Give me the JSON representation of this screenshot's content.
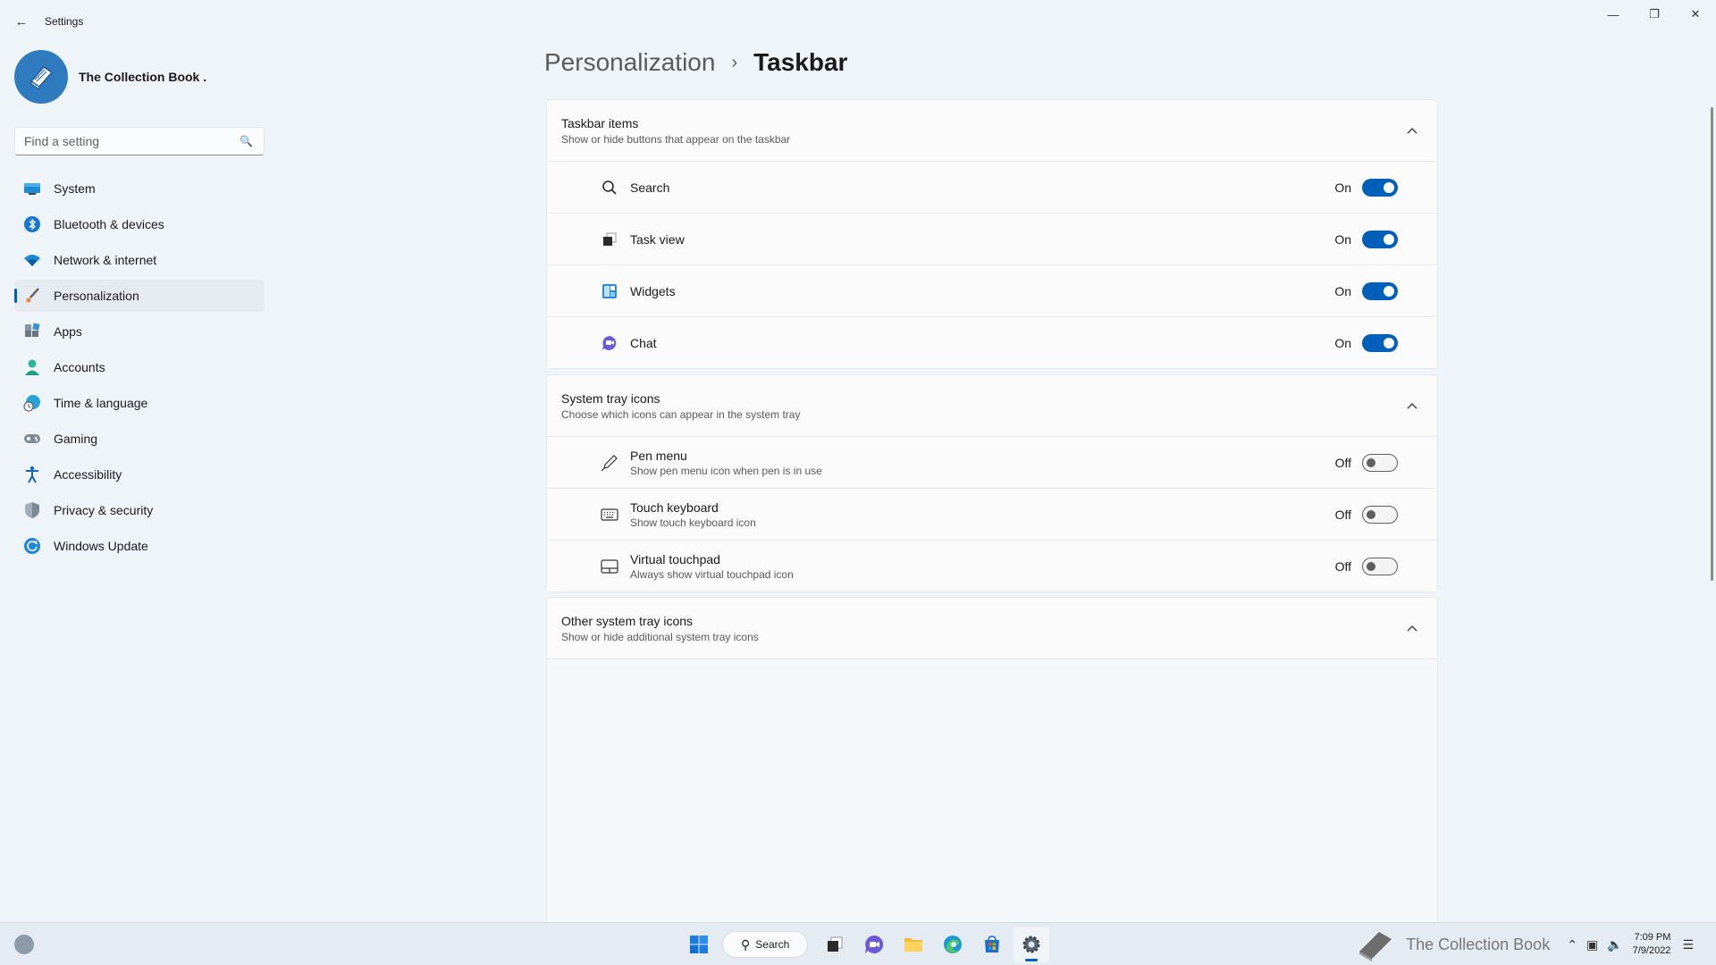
{
  "window": {
    "app_title": "Settings",
    "controls": [
      "minimize",
      "restore",
      "close"
    ]
  },
  "profile": {
    "name": "The Collection Book ."
  },
  "search": {
    "placeholder": "Find a setting"
  },
  "nav": {
    "active": "Personalization",
    "items": [
      {
        "label": "System",
        "icon": "monitor-icon"
      },
      {
        "label": "Bluetooth & devices",
        "icon": "bluetooth-icon"
      },
      {
        "label": "Network & internet",
        "icon": "wifi-icon"
      },
      {
        "label": "Personalization",
        "icon": "brush-icon"
      },
      {
        "label": "Apps",
        "icon": "apps-icon"
      },
      {
        "label": "Accounts",
        "icon": "person-icon"
      },
      {
        "label": "Time & language",
        "icon": "globe-clock-icon"
      },
      {
        "label": "Gaming",
        "icon": "gamepad-icon"
      },
      {
        "label": "Accessibility",
        "icon": "accessibility-icon"
      },
      {
        "label": "Privacy & security",
        "icon": "shield-icon"
      },
      {
        "label": "Windows Update",
        "icon": "update-icon"
      }
    ]
  },
  "breadcrumb": {
    "parent": "Personalization",
    "separator": "›",
    "current": "Taskbar"
  },
  "sections": {
    "taskbar_items": {
      "title": "Taskbar items",
      "subtitle": "Show or hide buttons that appear on the taskbar",
      "rows": [
        {
          "title": "Search",
          "state": "On"
        },
        {
          "title": "Task view",
          "state": "On"
        },
        {
          "title": "Widgets",
          "state": "On"
        },
        {
          "title": "Chat",
          "state": "On"
        }
      ]
    },
    "system_tray": {
      "title": "System tray icons",
      "subtitle": "Choose which icons can appear in the system tray",
      "rows": [
        {
          "title": "Pen menu",
          "subtitle": "Show pen menu icon when pen is in use",
          "state": "Off"
        },
        {
          "title": "Touch keyboard",
          "subtitle": "Show touch keyboard icon",
          "state": "Off"
        },
        {
          "title": "Virtual touchpad",
          "subtitle": "Always show virtual touchpad icon",
          "state": "Off"
        }
      ]
    },
    "other_tray": {
      "title": "Other system tray icons",
      "subtitle": "Show or hide additional system tray icons"
    }
  },
  "taskbar": {
    "search_label": "Search",
    "brand_text": "The Collection Book",
    "time": "7:09 PM",
    "date": "7/9/2022"
  },
  "colors": {
    "accent": "#005fb8",
    "background": "#eff4f9",
    "card": "#fbfbfc"
  }
}
